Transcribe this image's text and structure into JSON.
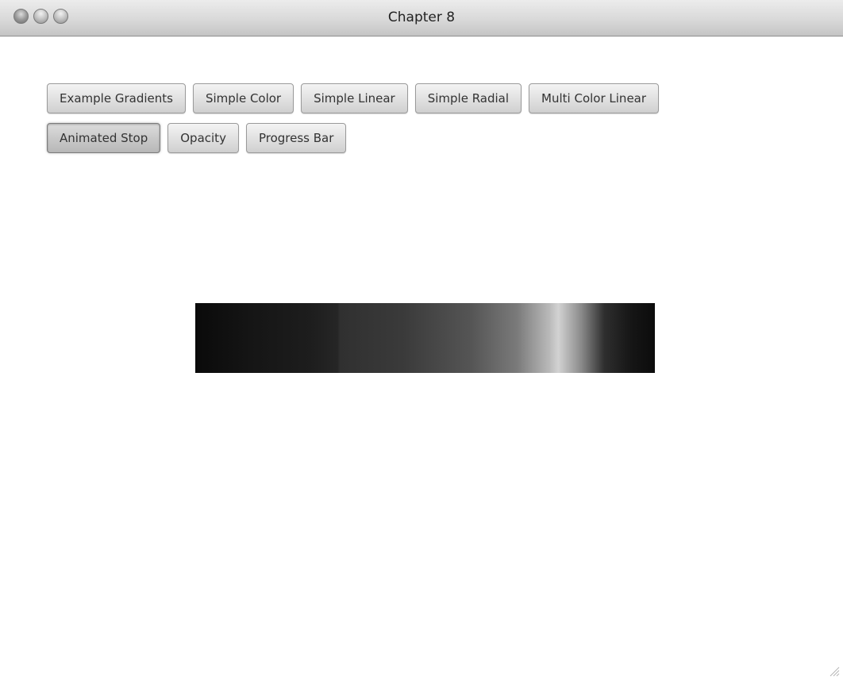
{
  "window": {
    "title": "Chapter 8"
  },
  "toolbar": {
    "row1": [
      {
        "label": "Example Gradients"
      },
      {
        "label": "Simple Color"
      },
      {
        "label": "Simple Linear"
      },
      {
        "label": "Simple Radial"
      },
      {
        "label": "Multi Color Linear"
      }
    ],
    "row2": [
      {
        "label": "Animated Stop",
        "active": true
      },
      {
        "label": "Opacity"
      },
      {
        "label": "Progress Bar"
      }
    ]
  },
  "colors": {
    "gradient_dark": "#0a0a0a",
    "gradient_highlight": "#d2d2d2",
    "background": "#ffffff"
  }
}
